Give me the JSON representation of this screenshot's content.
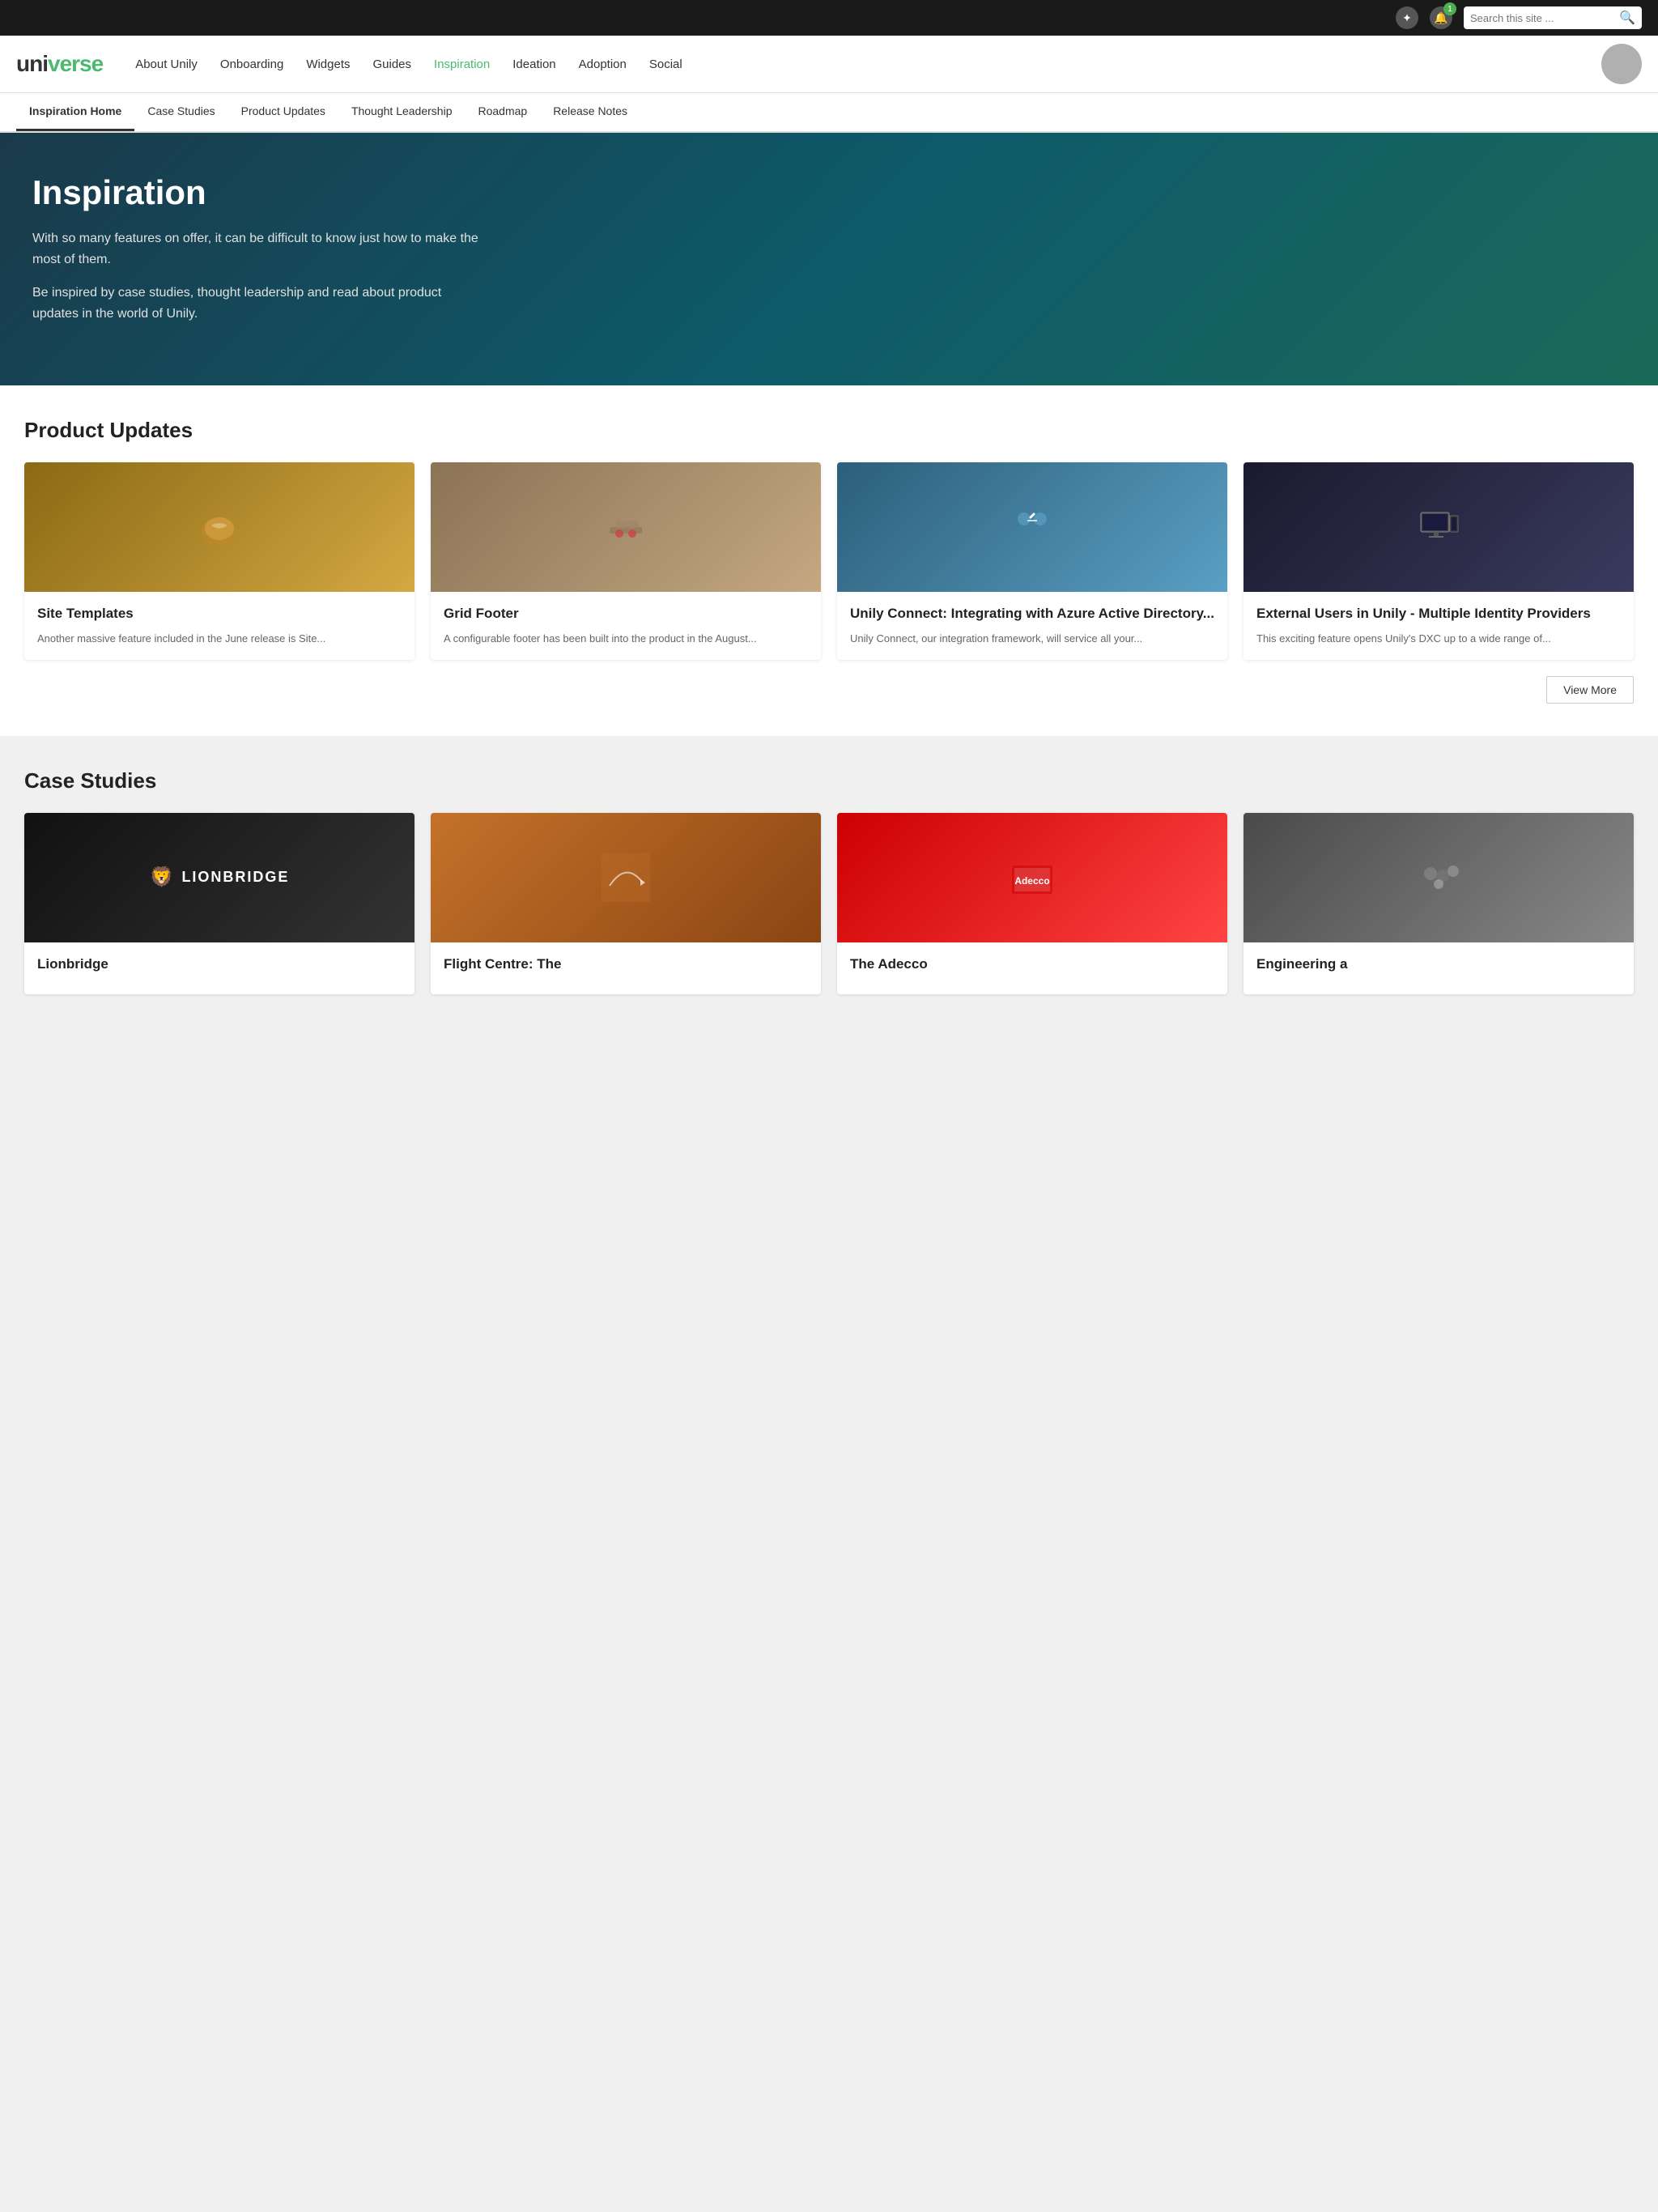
{
  "topbar": {
    "search_placeholder": "Search this site ...",
    "notification_count": "1"
  },
  "mainnav": {
    "logo_part1": "uni",
    "logo_part2": "verse",
    "links": [
      {
        "label": "About Unily",
        "active": false
      },
      {
        "label": "Onboarding",
        "active": false
      },
      {
        "label": "Widgets",
        "active": false
      },
      {
        "label": "Guides",
        "active": false
      },
      {
        "label": "Inspiration",
        "active": true
      },
      {
        "label": "Ideation",
        "active": false
      },
      {
        "label": "Adoption",
        "active": false
      },
      {
        "label": "Social",
        "active": false
      }
    ]
  },
  "subnav": {
    "links": [
      {
        "label": "Inspiration Home",
        "active": true
      },
      {
        "label": "Case Studies",
        "active": false
      },
      {
        "label": "Product Updates",
        "active": false
      },
      {
        "label": "Thought Leadership",
        "active": false
      },
      {
        "label": "Roadmap",
        "active": false
      },
      {
        "label": "Release Notes",
        "active": false
      }
    ]
  },
  "hero": {
    "title": "Inspiration",
    "paragraph1": "With so many features on offer, it can be difficult to know just how to make the most of them.",
    "paragraph2": "Be inspired by case studies, thought leadership and read about product updates in the world of Unily."
  },
  "product_updates": {
    "section_title": "Product Updates",
    "cards": [
      {
        "id": "site-templates",
        "title": "Site Templates",
        "excerpt": "Another massive feature included in the June release is Site...",
        "img_type": "coffee"
      },
      {
        "id": "grid-footer",
        "title": "Grid Footer",
        "excerpt": "A configurable footer has been built into the product in the August...",
        "img_type": "shoes"
      },
      {
        "id": "unily-connect",
        "title": "Unily Connect: Integrating with Azure Active Directory...",
        "excerpt": "Unily Connect, our integration framework, will service all your...",
        "img_type": "highfive"
      },
      {
        "id": "external-users",
        "title": "External Users in Unily - Multiple Identity Providers",
        "excerpt": "This exciting feature opens Unily's DXC up to a wide range of...",
        "img_type": "monitor"
      }
    ],
    "view_more_label": "View More"
  },
  "case_studies": {
    "section_title": "Case Studies",
    "cards": [
      {
        "id": "lionbridge",
        "title": "Lionbridge",
        "img_type": "lionbridge"
      },
      {
        "id": "flight-centre",
        "title": "Flight Centre: The",
        "img_type": "flight"
      },
      {
        "id": "adecco",
        "title": "The Adecco",
        "img_type": "adecco"
      },
      {
        "id": "engineering",
        "title": "Engineering a",
        "img_type": "party"
      }
    ]
  }
}
